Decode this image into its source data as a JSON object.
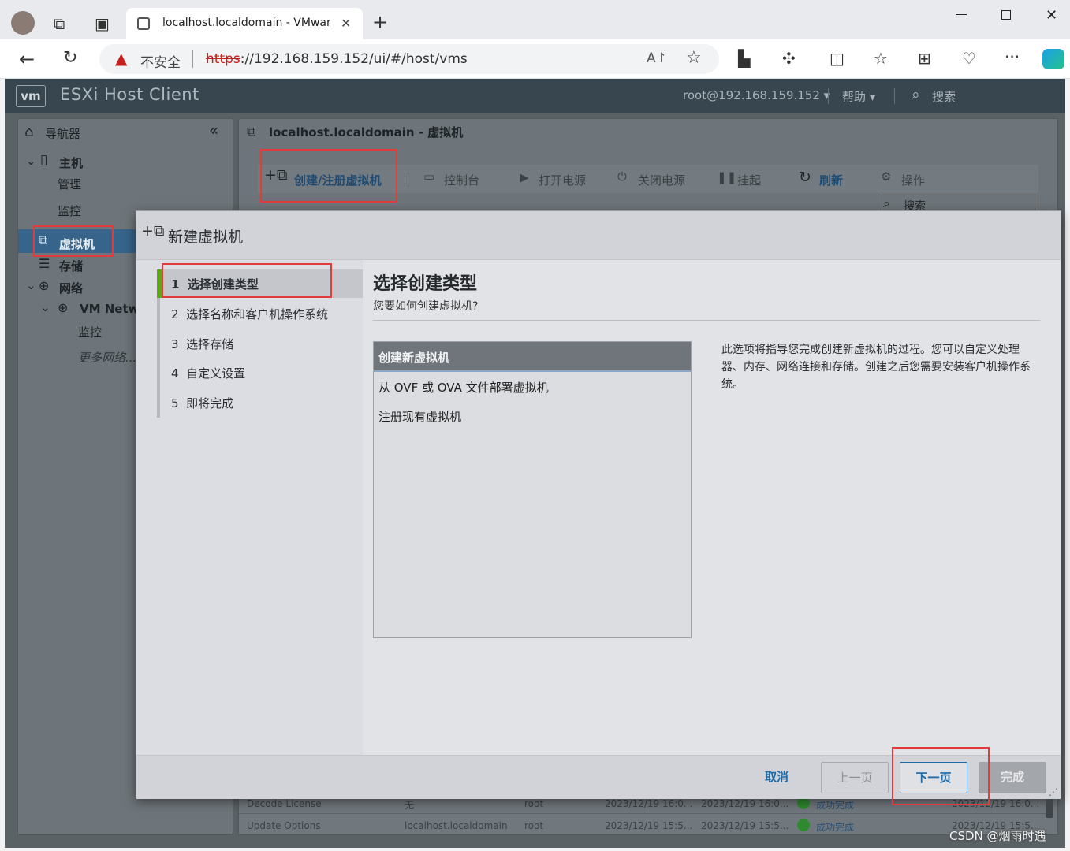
{
  "browser": {
    "tab_title": "localhost.localdomain - VMware",
    "address_security": "不安全",
    "address_https": "https",
    "address_rest": "://192.168.159.152/ui/#/host/vms"
  },
  "esxi": {
    "logo": "vm",
    "title": "ESXi Host Client",
    "user": "root@192.168.159.152 ▾",
    "help": "帮助 ▾",
    "search": "搜索"
  },
  "nav": {
    "title": "导航器",
    "host": "主机",
    "manage": "管理",
    "monitor": "监控",
    "vms": "虚拟机",
    "storage": "存储",
    "network": "网络",
    "vm_network": "VM Netwo",
    "net_monitor": "监控",
    "more_networks": "更多网络..."
  },
  "main": {
    "breadcrumb": "localhost.localdomain - 虚拟机",
    "toolbar": {
      "create": "创建/注册虚拟机",
      "console": "控制台",
      "power_on": "打开电源",
      "power_off": "关闭电源",
      "suspend": "挂起",
      "refresh": "刷新",
      "actions": "操作",
      "search": "搜索"
    },
    "tasks": [
      {
        "name": "Decode License",
        "target": "无",
        "initiator": "root",
        "queued": "2023/12/19 16:0...",
        "started": "2023/12/19 16:0...",
        "result": "成功完成",
        "completed": "2023/12/19 16:0..."
      },
      {
        "name": "Update Options",
        "target": "localhost.localdomain",
        "initiator": "root",
        "queued": "2023/12/19 15:5...",
        "started": "2023/12/19 15:5...",
        "result": "成功完成",
        "completed": "2023/12/19 15:5..."
      }
    ]
  },
  "dialog": {
    "title": "新建虚拟机",
    "steps": [
      {
        "num": "1",
        "label": "选择创建类型"
      },
      {
        "num": "2",
        "label": "选择名称和客户机操作系统"
      },
      {
        "num": "3",
        "label": "选择存储"
      },
      {
        "num": "4",
        "label": "自定义设置"
      },
      {
        "num": "5",
        "label": "即将完成"
      }
    ],
    "heading": "选择创建类型",
    "subheading": "您要如何创建虚拟机?",
    "options": [
      "创建新虚拟机",
      "从 OVF 或 OVA 文件部署虚拟机",
      "注册现有虚拟机"
    ],
    "description": "此选项将指导您完成创建新虚拟机的过程。您可以自定义处理器、内存、网络连接和存储。创建之后您需要安装客户机操作系统。",
    "buttons": {
      "cancel": "取消",
      "back": "上一页",
      "next": "下一页",
      "finish": "完成"
    }
  },
  "watermark": "CSDN @烟雨时遇",
  "colors": {
    "accent": "#1d6aa8",
    "highlight": "#e13b3b",
    "selected_step_bar": "#62a420"
  }
}
